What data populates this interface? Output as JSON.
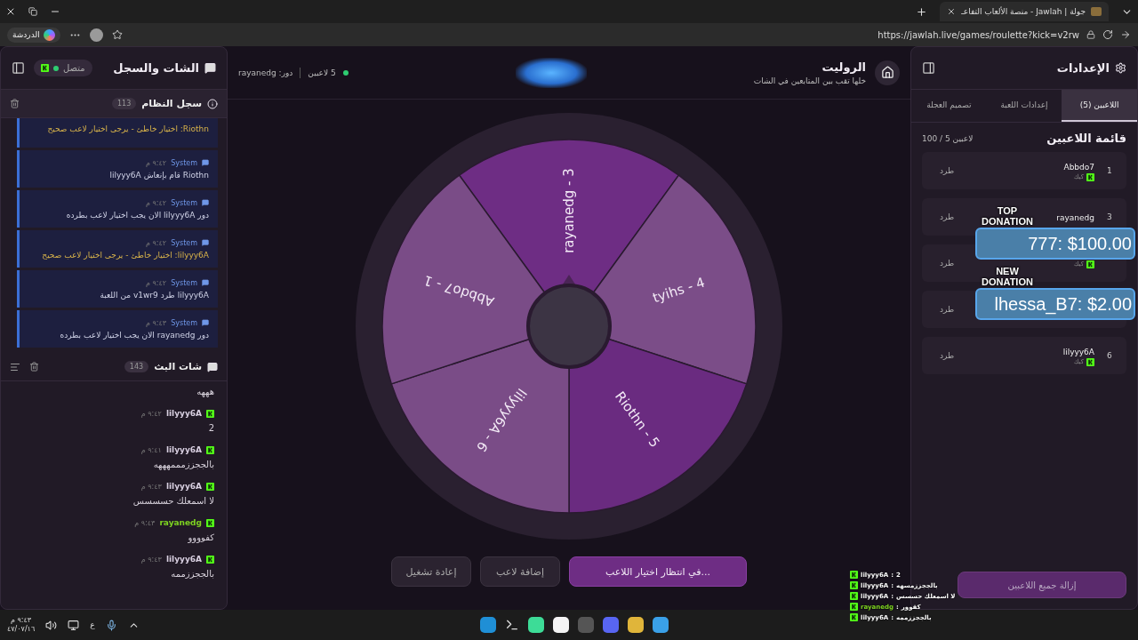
{
  "browser": {
    "tab_title": "جولة | Jawlah - منصة الألعاب التفاعـ",
    "url": "https://jawlah.live/games/roulette?kick=v2rw",
    "copilot_label": "الدردشة"
  },
  "chat_panel": {
    "title": "الشات والسجل",
    "status": "متصل",
    "system_log": {
      "title": "سجل النظام",
      "count": "113",
      "entries": [
        {
          "kind": "warning",
          "text": "Riothn: اختيار خاطئ - يرجى اختيار لاعب صحيح"
        },
        {
          "kind": "info",
          "sender": "System",
          "time": "٩:٤٢ م",
          "text": "Riothn قام بإنعاش lilyyy6A"
        },
        {
          "kind": "info",
          "sender": "System",
          "time": "٩:٤٢ م",
          "text": "دور lilyyy6A الان يجب اختيار لاعب بطرده"
        },
        {
          "kind": "warning",
          "sender": "System",
          "time": "٩:٤٢ م",
          "text": "lilyyy6A: اختيار خاطئ - يرجى اختيار لاعب صحيح"
        },
        {
          "kind": "info",
          "sender": "System",
          "time": "٩:٤٢ م",
          "text": "lilyyy6A طرد v1wr9 من اللعبة"
        },
        {
          "kind": "info",
          "sender": "System",
          "time": "٩:٤٣ م",
          "text": "دور rayanedg الان يجب اختيار لاعب بطرده"
        }
      ]
    },
    "live_chat": {
      "title": "شات البث",
      "count": "143",
      "messages": [
        {
          "text": "هههه"
        },
        {
          "user": "lilyyy6A",
          "color": "#d8cfe0",
          "time": "٩:٤٢ م",
          "text": "2"
        },
        {
          "user": "lilyyy6A",
          "color": "#d8cfe0",
          "time": "٩:٤١ م",
          "text": "بالججززمممهههه"
        },
        {
          "user": "lilyyy6A",
          "color": "#d8cfe0",
          "time": "٩:٤٣ م",
          "text": "لا اسمعلك حسسسس"
        },
        {
          "user": "rayanedg",
          "color": "#7ed321",
          "time": "٩:٤٣ م",
          "text": "كفوووو"
        },
        {
          "user": "lilyyy6A",
          "color": "#d8cfe0",
          "time": "٩:٤٣ م",
          "text": "بالججززممه"
        }
      ]
    }
  },
  "game": {
    "title": "الروليت",
    "subtitle": "خلها تقب بين المتابعين في الشات",
    "players_count": "5 لاعبين",
    "turn": "دور: rayanedg",
    "wheel": {
      "segments": [
        {
          "label": "rayanedg - 3",
          "color": "#6e2d84"
        },
        {
          "label": "tyihs - 4",
          "color": "#7b4d88"
        },
        {
          "label": "Riothn - 5",
          "color": "#6a2b80"
        },
        {
          "label": "lilyyy6A - 6",
          "color": "#7a4c87"
        },
        {
          "label": "Abbdo7 - 1",
          "color": "#7a4c87"
        }
      ]
    },
    "buttons": [
      {
        "kind": "primary",
        "label": "في انتظار اختيار اللاعب..."
      },
      {
        "kind": "secondary",
        "label": "إضافة لاعب"
      },
      {
        "kind": "secondary",
        "label": "إعادة تشغيل"
      }
    ]
  },
  "settings": {
    "title": "الإعدادات",
    "tabs": [
      {
        "label": "اللاعبين (5)",
        "selected": true
      },
      {
        "label": "إعدادات اللعبة",
        "selected": false
      },
      {
        "label": "تصميم العجلة",
        "selected": false
      }
    ],
    "list_title": "قائمة اللاعبين",
    "list_count": "100 / 5 لاعبين",
    "players": [
      {
        "number": "1",
        "name": "Abbdo7",
        "platform": "كيك",
        "action": "طرد"
      },
      {
        "number": "3",
        "name": "rayanedg",
        "action": "طرد"
      },
      {
        "platform": "كيك",
        "action": "طرد"
      },
      {
        "action": "طرد"
      },
      {
        "number": "6",
        "name": "lilyyy6A",
        "platform": "كيك",
        "action": "طرد"
      }
    ],
    "remove_all": "إزالة جميع اللاعبين"
  },
  "donations": [
    {
      "heading": "TOP DONATION",
      "text": "777: $100.00"
    },
    {
      "heading": "NEW DONATION",
      "text": "lhessa_B7: $2.00"
    }
  ],
  "stream_overlay": [
    {
      "user": "lilyyy6A",
      "separator": ":",
      "text": "2"
    },
    {
      "user": "lilyyy6A",
      "separator": ":",
      "text": "بالججززمسهه"
    },
    {
      "user": "lilyyy6A",
      "separator": ":",
      "text": "لا اسمعلك حسسس"
    },
    {
      "user": "rayanedg",
      "separator": ":",
      "text": "كفوور"
    },
    {
      "user": "lilyyy6A",
      "separator": ":",
      "text": "بالججززممه"
    }
  ],
  "taskbar": {
    "time": "٩:٤٣ م",
    "date": "٤٧/٠٧/١٦",
    "language": "ع"
  }
}
